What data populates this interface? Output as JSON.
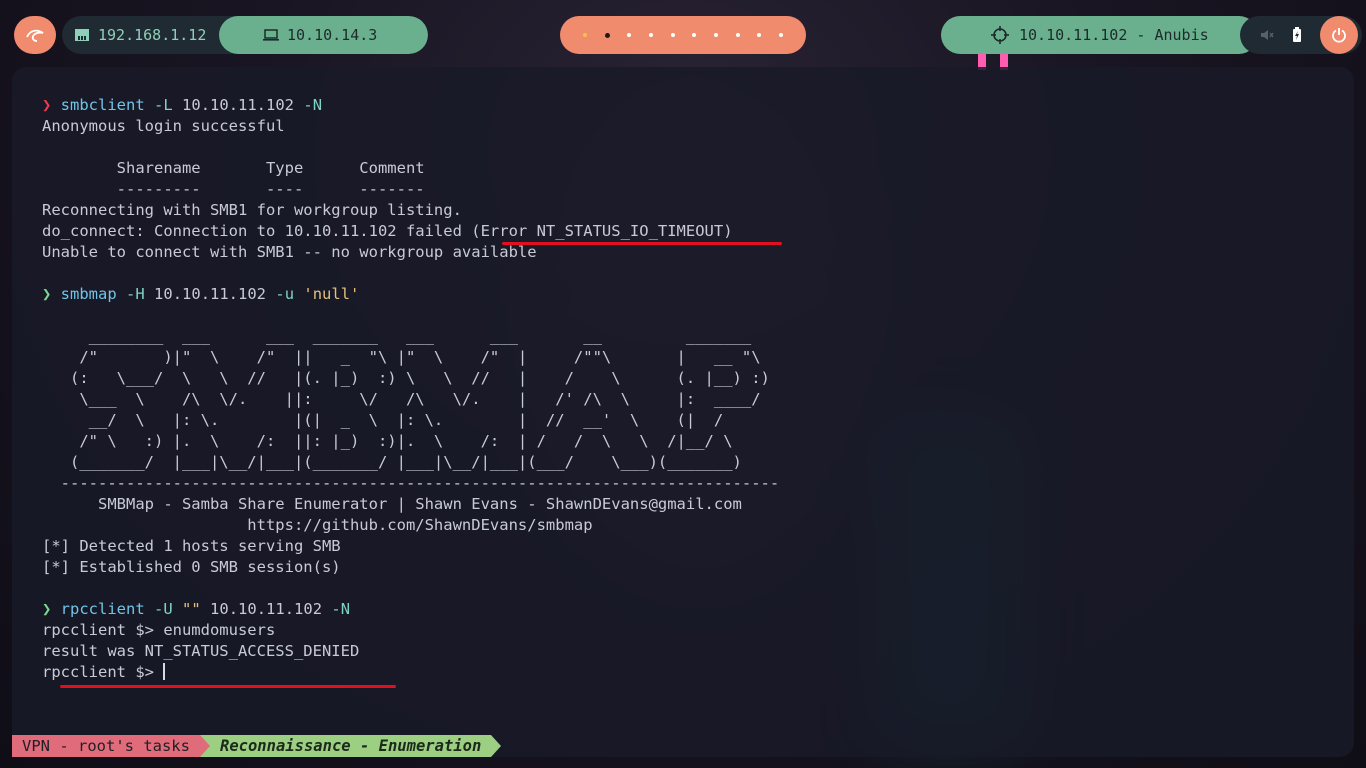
{
  "topbar": {
    "lan_ip": "192.168.1.12",
    "vpn_ip": "10.10.14.3",
    "workspace_count": 10,
    "target": "10.10.11.102 - Anubis",
    "icons": {
      "logo": "kali-dragon-icon",
      "lan": "ethernet-icon",
      "vpn": "laptop-icon",
      "target": "crosshair-icon",
      "volume": "speaker-muted-icon",
      "battery": "battery-charging-icon",
      "power": "power-icon"
    }
  },
  "terminal": {
    "lines": [
      {
        "prompt": "❯",
        "cmd": "smbclient",
        "args": [
          {
            "t": "flag",
            "v": "-L"
          },
          {
            "t": "plain",
            "v": "10.10.11.102"
          },
          {
            "t": "flag",
            "v": "-N"
          }
        ]
      },
      "Anonymous login successful",
      "",
      "        Sharename       Type      Comment",
      "        ---------       ----      -------",
      "Reconnecting with SMB1 for workgroup listing.",
      "do_connect: Connection to 10.10.11.102 failed (Error NT_STATUS_IO_TIMEOUT)",
      "Unable to connect with SMB1 -- no workgroup available",
      "",
      {
        "prompt": "❯",
        "cmd": "smbmap",
        "args": [
          {
            "t": "flag",
            "v": "-H"
          },
          {
            "t": "plain",
            "v": "10.10.11.102"
          },
          {
            "t": "flag",
            "v": "-u"
          },
          {
            "t": "str",
            "v": "'null'"
          }
        ]
      }
    ],
    "ascii_art": [
      "",
      "     ________  ___      ___  _______   ___      ___       __         _______",
      "    /\"       )|\"  \\    /\"  ||   _  \"\\ |\"  \\    /\"  |     /\"\"\\       |   __ \"\\",
      "   (:   \\___/  \\   \\  //   |(. |_)  :) \\   \\  //   |    /    \\      (. |__) :)",
      "    \\___  \\    /\\  \\/.    ||:     \\/   /\\   \\/.    |   /' /\\  \\     |:  ____/",
      "     __/  \\   |: \\.        |(|  _  \\  |: \\.        |  //  __'  \\    (|  /",
      "    /\" \\   :) |.  \\    /:  ||: |_)  :)|.  \\    /:  | /   /  \\   \\  /|__/ \\",
      "   (_______/  |___|\\__/|___|(_______/ |___|\\__/|___|(___/    \\___)(_______)",
      "  -----------------------------------------------------------------------------",
      "      SMBMap - Samba Share Enumerator | Shawn Evans - ShawnDEvans@gmail.com",
      "                      https://github.com/ShawnDEvans/smbmap",
      ""
    ],
    "lines2": [
      "[*] Detected 1 hosts serving SMB",
      "[*] Established 0 SMB session(s)",
      "",
      {
        "prompt": "❯",
        "cmd": "rpcclient",
        "args": [
          {
            "t": "flag",
            "v": "-U"
          },
          {
            "t": "str",
            "v": "\"\""
          },
          {
            "t": "plain",
            "v": "10.10.11.102"
          },
          {
            "t": "flag",
            "v": "-N"
          }
        ]
      },
      "rpcclient $> enumdomusers",
      "result was NT_STATUS_ACCESS_DENIED",
      "rpcclient $> "
    ]
  },
  "statusbar": {
    "session": "VPN - root's tasks",
    "window": "Reconnaissance - Enumeration"
  },
  "colors": {
    "accent_orange": "#f08b6e",
    "accent_green": "#6ab08e",
    "highlight_red": "#e01020"
  }
}
